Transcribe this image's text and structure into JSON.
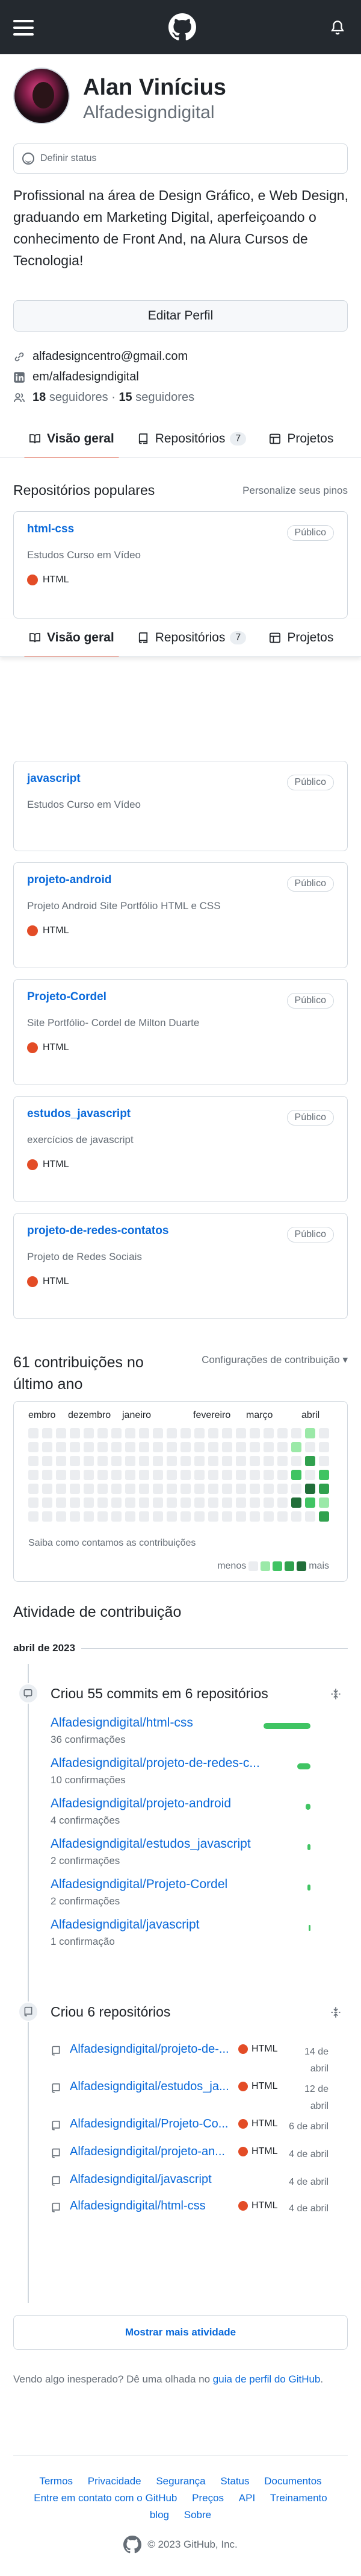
{
  "header": {
    "menu_icon": "hamburger-icon",
    "logo_icon": "github-logo-icon",
    "notifications_icon": "bell-icon"
  },
  "profile": {
    "name": "Alan Vinícius",
    "login": "Alfadesigndigital",
    "status_placeholder": "Definir status",
    "bio": "Profissional na área de Design Gráfico, e Web Design, graduando em Marketing Digital, aperfeiçoando o conhecimento de Front And, na Alura Cursos de Tecnologia!",
    "edit_button": "Editar Perfil",
    "email": "alfadesigncentro@gmail.com",
    "linkedin": "em/alfadesigndigital",
    "followers_count": "18",
    "followers_label": "seguidores",
    "following_count": "15",
    "following_label": "seguidores"
  },
  "tabs": [
    {
      "label": "Visão geral",
      "icon": "book-icon",
      "active": true
    },
    {
      "label": "Repositórios",
      "icon": "repo-icon",
      "counter": "7"
    },
    {
      "label": "Projetos",
      "icon": "table-icon"
    }
  ],
  "popular": {
    "title": "Repositórios populares",
    "customize": "Personalize seus pinos",
    "pinned": {
      "name": "html-css",
      "visibility": "Público",
      "description": "Estudos Curso em Vídeo",
      "language": "HTML"
    }
  },
  "repos": [
    {
      "name": "javascript",
      "visibility": "Público",
      "description": "Estudos Curso em Vídeo",
      "language": ""
    },
    {
      "name": "projeto-android",
      "visibility": "Público",
      "description": "Projeto Android Site Portfólio HTML e CSS",
      "language": "HTML"
    },
    {
      "name": "Projeto-Cordel",
      "visibility": "Público",
      "description": "Site Portfólio- Cordel de Milton Duarte",
      "language": "HTML"
    },
    {
      "name": "estudos_javascript",
      "visibility": "Público",
      "description": "exercícios de javascript",
      "language": "HTML"
    },
    {
      "name": "projeto-de-redes-contatos",
      "visibility": "Público",
      "description": "Projeto de Redes Sociais",
      "language": "HTML"
    }
  ],
  "contributions": {
    "heading": "61 contribuições no último ano",
    "settings": "Configurações de contribuição ▾",
    "months": [
      "embro",
      "dezembro",
      "janeiro",
      "fevereiro",
      "março",
      "abril"
    ],
    "learn_more": "Saiba como contamos as contribuições",
    "less_label": "menos",
    "more_label": "mais",
    "level_colors": [
      "#ebedf0",
      "#9be9a8",
      "#40c463",
      "#30a14e",
      "#216e39"
    ]
  },
  "activity": {
    "title": "Atividade de contribuição",
    "month": "abril de 2023",
    "commits_title": "Criou 55 commits em 6 repositórios",
    "commits": [
      {
        "repo": "Alfadesigndigital/html-css",
        "count": "36 confirmações",
        "share": 0.65
      },
      {
        "repo": "Alfadesigndigital/projeto-de-redes-c...",
        "count": "10 confirmações",
        "share": 0.18
      },
      {
        "repo": "Alfadesigndigital/projeto-android",
        "count": "4 confirmações",
        "share": 0.07
      },
      {
        "repo": "Alfadesigndigital/estudos_javascript",
        "count": "2 confirmações",
        "share": 0.04
      },
      {
        "repo": "Alfadesigndigital/Projeto-Cordel",
        "count": "2 confirmações",
        "share": 0.04
      },
      {
        "repo": "Alfadesigndigital/javascript",
        "count": "1 confirmação",
        "share": 0.02
      }
    ],
    "created_title": "Criou 6 repositórios",
    "created": [
      {
        "repo": "Alfadesigndigital/projeto-de-...",
        "language": "HTML",
        "date_a": "14 de",
        "date_b": "abril"
      },
      {
        "repo": "Alfadesigndigital/estudos_ja...",
        "language": "HTML",
        "date_a": "12 de",
        "date_b": "abril"
      },
      {
        "repo": "Alfadesigndigital/Projeto-Co...",
        "language": "HTML",
        "date_a": "6 de abril",
        "date_b": ""
      },
      {
        "repo": "Alfadesigndigital/projeto-an...",
        "language": "HTML",
        "date_a": "4 de abril",
        "date_b": ""
      },
      {
        "repo": "Alfadesigndigital/javascript",
        "language": "",
        "date_a": "4 de abril",
        "date_b": ""
      },
      {
        "repo": "Alfadesigndigital/html-css",
        "language": "HTML",
        "date_a": "4 de abril",
        "date_b": ""
      }
    ],
    "show_more": "Mostrar mais atividade",
    "unexpected_text": "Vendo algo inesperado? Dê uma olhada no",
    "unexpected_link": "guia de perfil do GitHub",
    "unexpected_end": "."
  },
  "footer": {
    "links": [
      "Termos",
      "Privacidade",
      "Segurança",
      "Status",
      "Documentos",
      "Entre em contato com o GitHub",
      "Preços",
      "API",
      "Treinamento",
      "blog",
      "Sobre"
    ],
    "copyright": "© 2023 GitHub, Inc."
  }
}
